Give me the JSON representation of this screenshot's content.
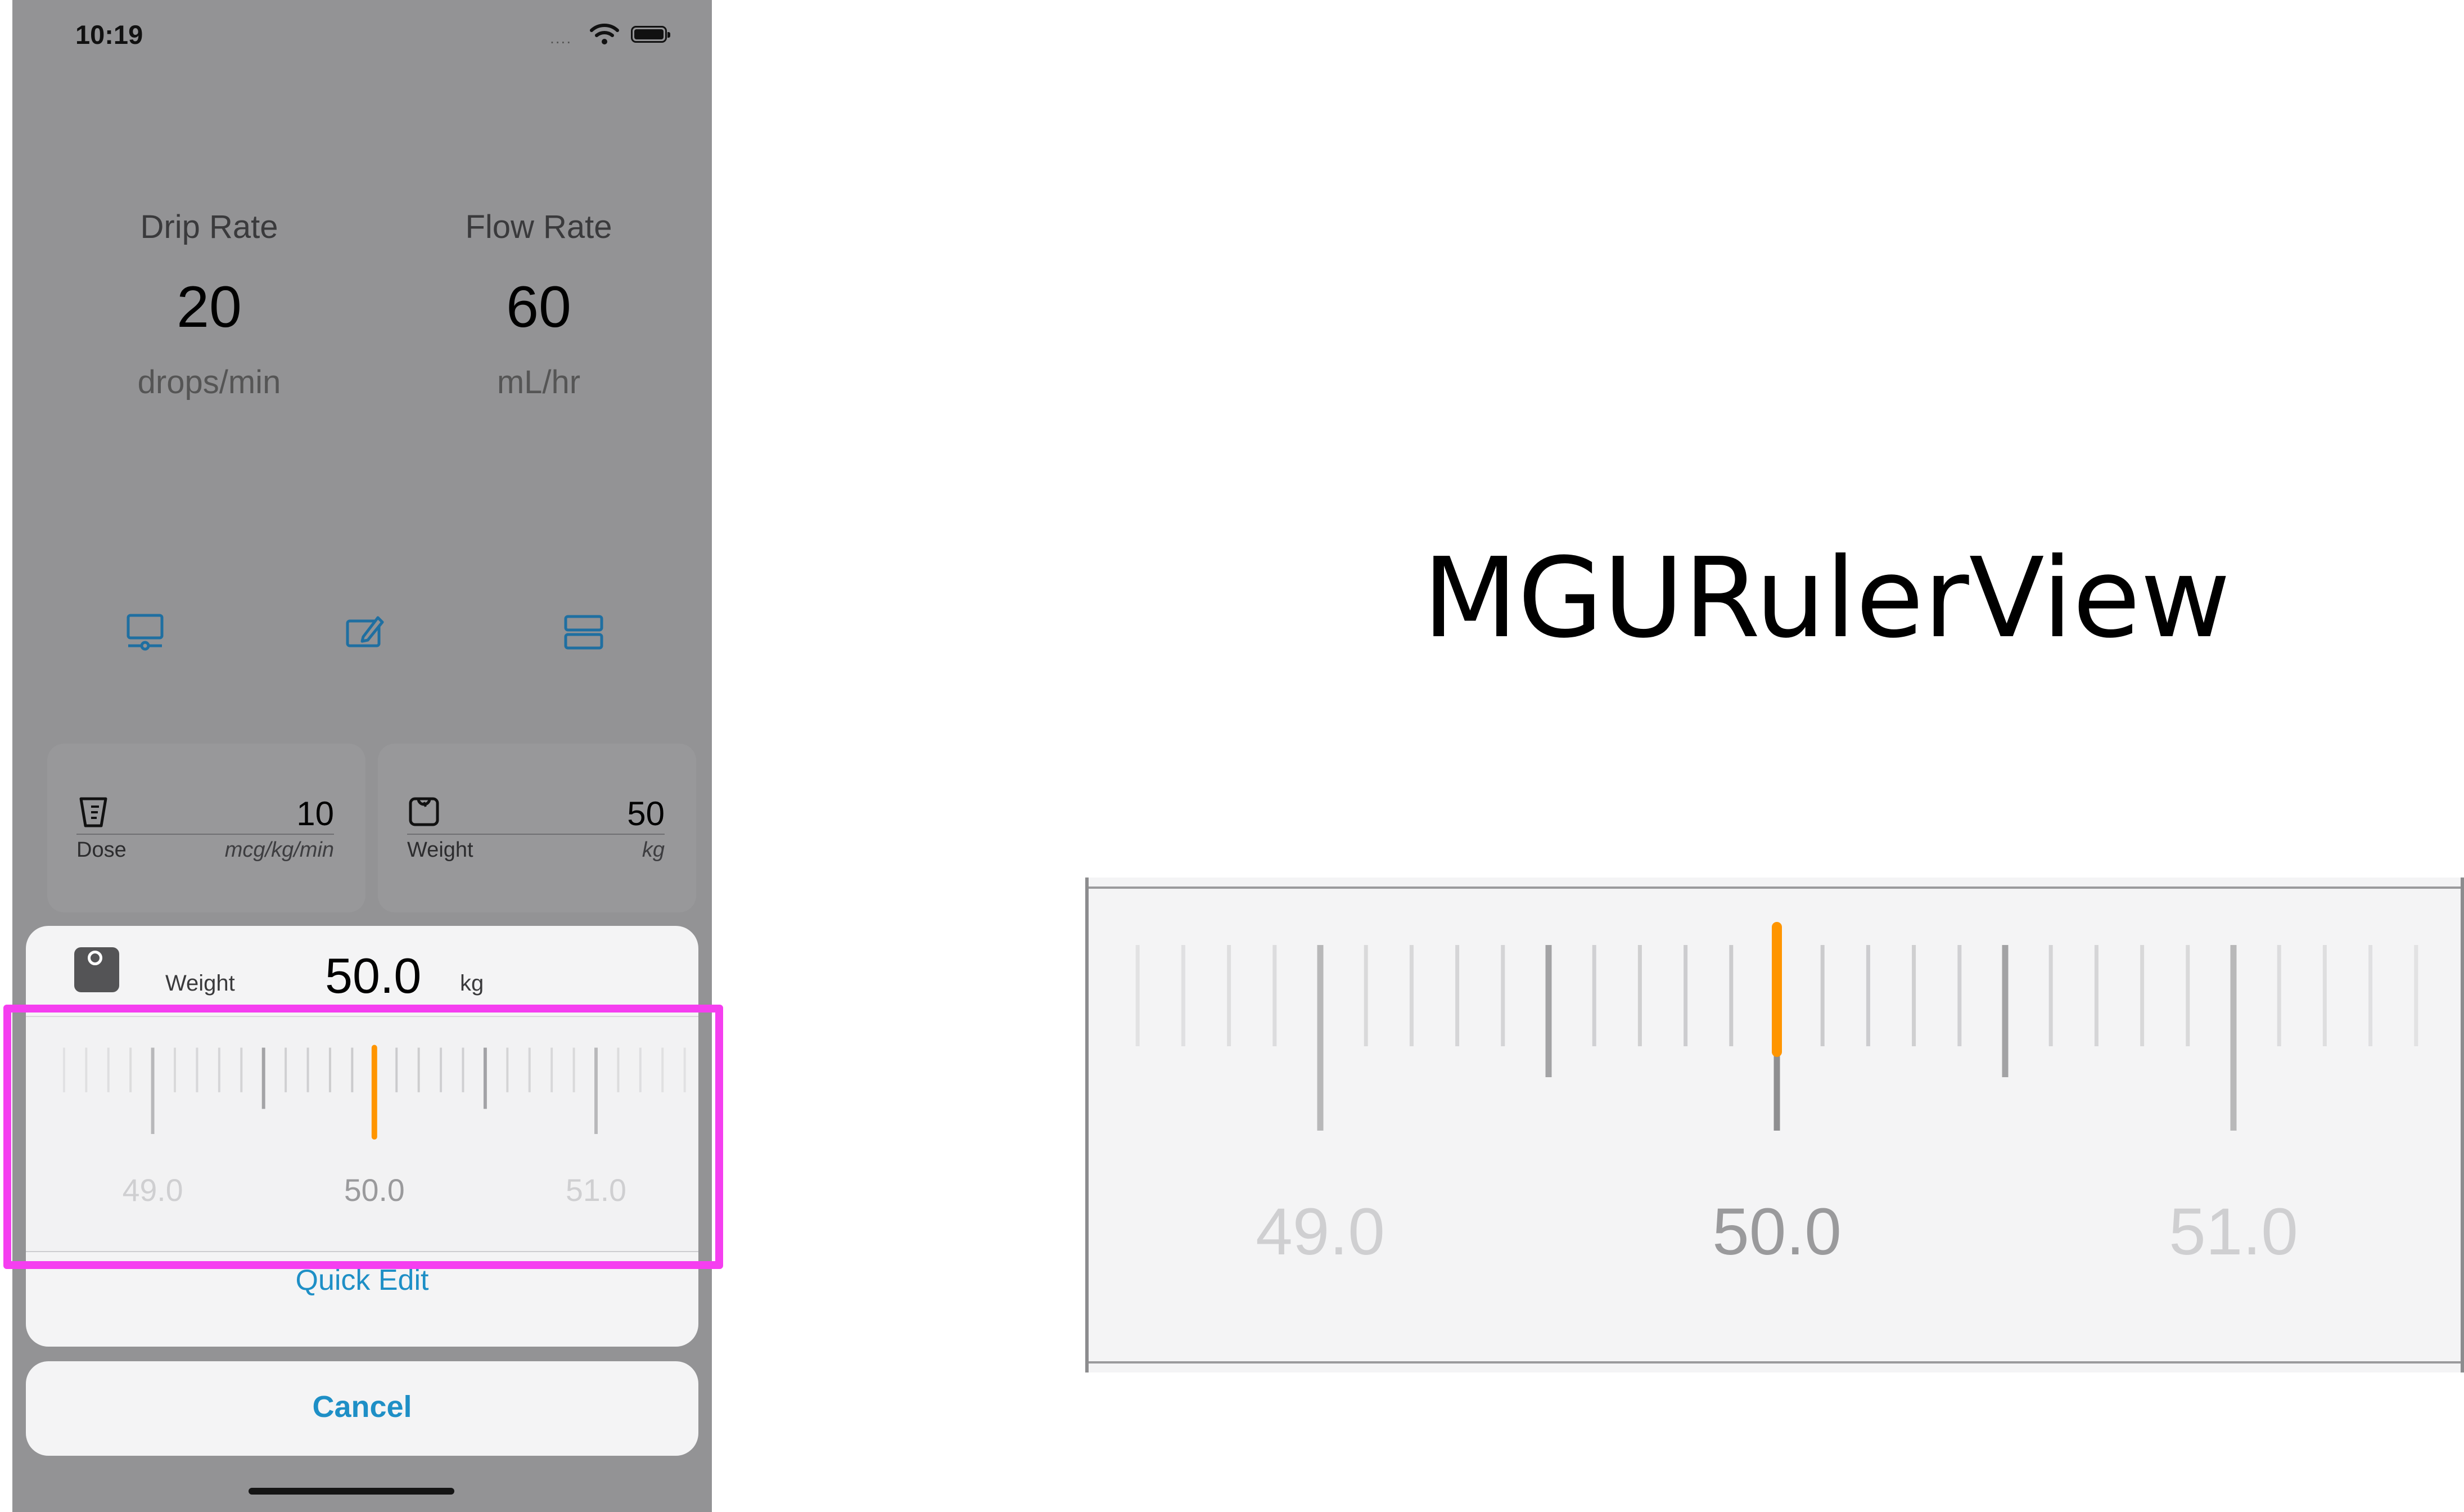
{
  "status_bar": {
    "time": "10:19",
    "signal": "....",
    "wifi_icon": "wifi-icon",
    "battery_icon": "battery-icon"
  },
  "rates": [
    {
      "label": "Drip Rate",
      "value": "20",
      "unit": "drops/min"
    },
    {
      "label": "Flow Rate",
      "value": "60",
      "unit": "mL/hr"
    }
  ],
  "toolbar_icons": [
    "monitor-icon",
    "edit-icon",
    "list-icon"
  ],
  "inputs": [
    {
      "icon": "dose-cup-icon",
      "value": "10",
      "name": "Dose",
      "unit": "mcg/kg/min"
    },
    {
      "icon": "scale-icon",
      "value": "50",
      "name": "Weight",
      "unit": "kg"
    }
  ],
  "sheet": {
    "icon": "scale-icon",
    "title": "Weight",
    "value": "50.0",
    "unit": "kg",
    "quick_edit": "Quick Edit",
    "cancel": "Cancel"
  },
  "ruler": {
    "min": 49.0,
    "max": 51.0,
    "step": 0.1,
    "selected": 50.0,
    "labels": [
      "49.0",
      "50.0",
      "51.0"
    ],
    "accent_color": "#ff9500"
  },
  "right_title": "MGURulerView",
  "big_ruler": {
    "labels": [
      "49.0",
      "50.0",
      "51.0"
    ],
    "selected": 50.0
  },
  "highlight_color": "#f53ef0"
}
